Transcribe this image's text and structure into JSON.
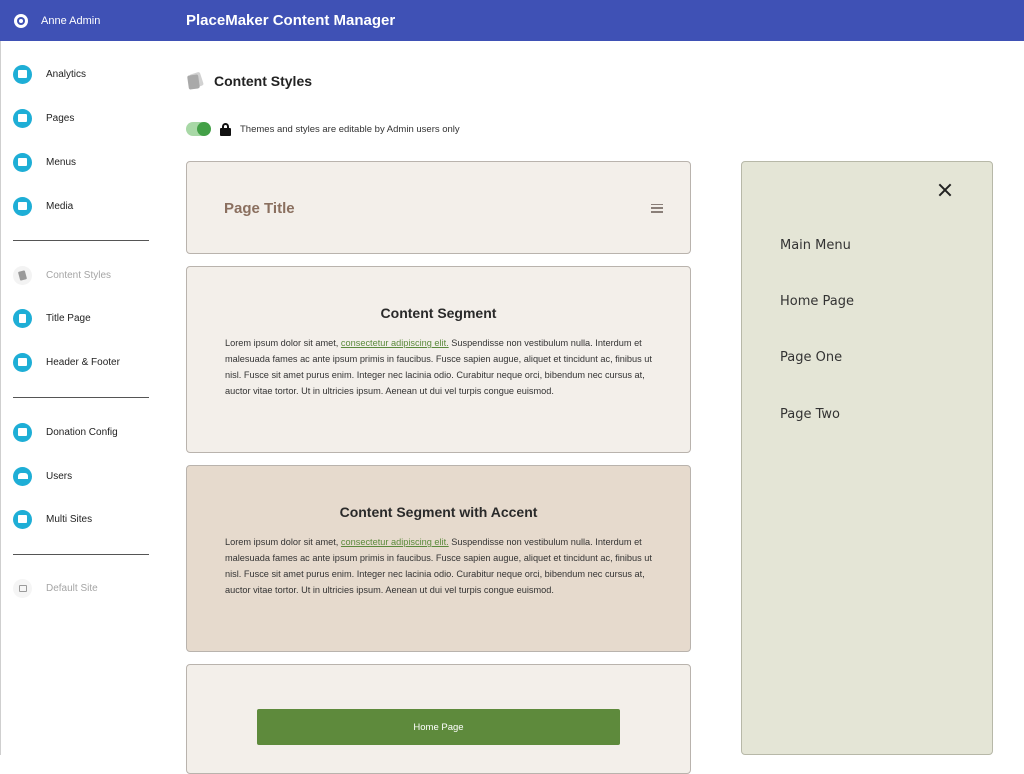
{
  "topbar": {
    "user_name": "Anne Admin",
    "app_title": "PlaceMaker Content Manager",
    "color": "#3f51b5"
  },
  "sidebar": {
    "groups": [
      {
        "items": [
          {
            "label": "Analytics",
            "icon": "analytics-icon"
          },
          {
            "label": "Pages",
            "icon": "pages-icon"
          },
          {
            "label": "Menus",
            "icon": "menu-icon"
          },
          {
            "label": "Media",
            "icon": "media-icon"
          }
        ]
      },
      {
        "items": [
          {
            "label": "Content Styles",
            "icon": "content-styles-icon",
            "active": true
          },
          {
            "label": "Title Page",
            "icon": "title-page-icon"
          },
          {
            "label": "Header & Footer",
            "icon": "header-footer-icon"
          }
        ]
      },
      {
        "items": [
          {
            "label": "Donation Config",
            "icon": "donation-icon"
          },
          {
            "label": "Users",
            "icon": "users-icon"
          },
          {
            "label": "Multi Sites",
            "icon": "multi-sites-icon"
          }
        ]
      },
      {
        "items": [
          {
            "label": "Default Site",
            "icon": "site-icon",
            "disabled": true
          }
        ]
      }
    ],
    "icon_color": "#1eaed6"
  },
  "main": {
    "heading": "Content Styles",
    "toggle": {
      "on": true,
      "label": "Themes and styles are editable by Admin users only"
    },
    "preview": {
      "page_title": "Page Title",
      "segment": {
        "title": "Content Segment",
        "text_before": "Lorem ipsum dolor sit amet, ",
        "link_text": "consectetur adipiscing elit.",
        "text_after": " Suspendisse non vestibulum nulla. Interdum et malesuada fames ac ante ipsum primis in faucibus. Fusce sapien augue, aliquet et tincidunt ac, finibus ut nisl. Fusce sit amet purus enim. Integer nec lacinia odio. Curabitur neque orci, bibendum nec cursus at, auctor vitae tortor. Ut in ultricies ipsum. Aenean ut dui vel turpis congue euismod."
      },
      "accent_segment": {
        "title": "Content Segment with Accent",
        "text_before": "Lorem ipsum dolor sit amet, ",
        "link_text": "consectetur adipiscing elit.",
        "text_after": " Suspendisse non vestibulum nulla. Interdum et malesuada fames ac ante ipsum primis in faucibus. Fusce sapien augue, aliquet et tincidunt ac, finibus ut nisl. Fusce sit amet purus enim. Integer nec lacinia odio. Curabitur neque orci, bibendum nec cursus at, auctor vitae tortor. Ut in ultricies ipsum. Aenean ut dui vel turpis congue euismod."
      },
      "button_label": "Home Page",
      "colors": {
        "card_bg": "#f3efea",
        "accent_bg": "#e6dacd",
        "title_color": "#8a6f5f",
        "link_color": "#5b8a3c",
        "button_color": "#5e8a3c"
      }
    },
    "menu_panel": {
      "items": [
        "Main Menu",
        "Home Page",
        "Page One",
        "Page Two"
      ],
      "background": "#e4e5d6"
    }
  }
}
